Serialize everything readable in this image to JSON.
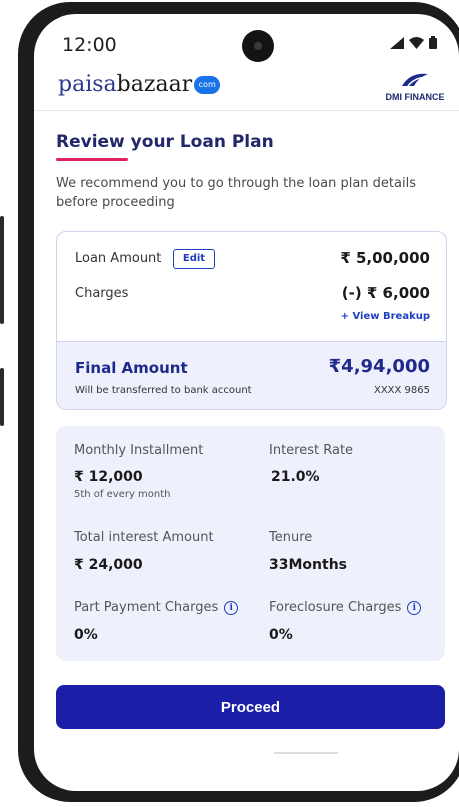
{
  "status_bar": {
    "time": "12:00"
  },
  "header": {
    "logo_part1": "paisa",
    "logo_part2": "bazaar",
    "logo_badge": "com",
    "partner_name": "DMI FINANCE"
  },
  "page": {
    "title": "Review your Loan Plan",
    "subtitle": "We recommend you to go through the loan plan details before proceeding"
  },
  "amount_card": {
    "loan_amount_label": "Loan Amount",
    "edit_label": "Edit",
    "loan_amount_value": "₹ 5,00,000",
    "charges_label": "Charges",
    "charges_value": "(-) ₹ 6,000",
    "view_breakup_label": "+ View Breakup",
    "final_amount_label": "Final Amount",
    "final_amount_value": "₹4,94,000",
    "final_note": "Will be transferred to bank account",
    "account_number": "XXXX 9865"
  },
  "details": {
    "monthly_installment_label": "Monthly Installment",
    "monthly_installment_value": "₹ 12,000",
    "monthly_installment_note": "5th of every month",
    "interest_rate_label": "Interest Rate",
    "interest_rate_value": "21.0%",
    "total_interest_label": "Total interest Amount",
    "total_interest_value": "₹ 24,000",
    "tenure_label": "Tenure",
    "tenure_value": "33Months",
    "part_payment_label": "Part Payment Charges",
    "part_payment_value": "0%",
    "foreclosure_label": "Foreclosure Charges",
    "foreclosure_value": "0%"
  },
  "actions": {
    "proceed_label": "Proceed"
  },
  "colors": {
    "primary": "#1b1fa8",
    "accent_underline": "#e0245e",
    "card_tint": "#eef0fb"
  },
  "icons": [
    "camera-icon",
    "signal-icon",
    "wifi-icon",
    "battery-icon",
    "dmi-logo-icon",
    "info-icon"
  ]
}
